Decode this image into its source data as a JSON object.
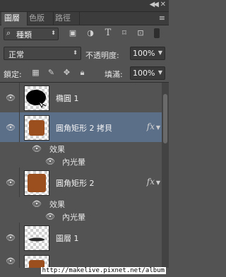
{
  "topbar": {
    "collapse_icon": "double-chevron-left",
    "close_icon": "close"
  },
  "tabs": [
    {
      "label": "圖層"
    },
    {
      "label": "色版"
    },
    {
      "label": "路徑"
    }
  ],
  "filter": {
    "kind_value": "種類",
    "icons": [
      "image-filter",
      "adjustment-filter",
      "type-filter",
      "shape-filter",
      "smart-object-filter"
    ]
  },
  "blend": {
    "mode": "正常",
    "opacity_label": "不透明度:",
    "opacity_value": "100%"
  },
  "lock": {
    "label": "鎖定:",
    "fill_label": "填滿:",
    "fill_value": "100%"
  },
  "layers": [
    {
      "name": "橢圓 1"
    },
    {
      "name": "圓角矩形 2 拷貝",
      "fx": "fx",
      "effects_label": "效果",
      "effect": "內光暈"
    },
    {
      "name": "圓角矩形 2",
      "fx": "fx",
      "effects_label": "效果",
      "effect": "內光暈"
    },
    {
      "name": "圖層 1"
    }
  ],
  "watermark": "http://makelive.pixnet.net/album",
  "colors": {
    "panel_bg": "#535353",
    "selected_row": "#5b6f89",
    "thumb_brown": "#9b4f1f"
  }
}
